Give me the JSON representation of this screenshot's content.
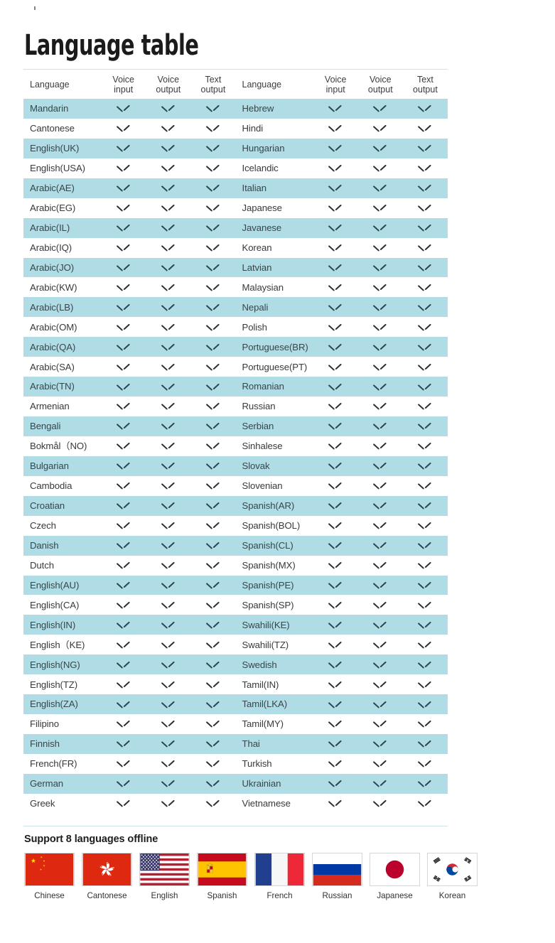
{
  "page_title": "Language table",
  "table": {
    "headers": {
      "language": "Language",
      "voice_input": "Voice\ninput",
      "voice_output": "Voice\noutput",
      "text_output": "Text\noutput",
      "voice_input_l1": "Voice",
      "voice_input_l2": "input",
      "voice_output_l1": "Voice",
      "voice_output_l2": "output",
      "text_output_l1": "Text",
      "text_output_l2": "output"
    },
    "check_glyph": "check-mark",
    "alt_row_color": "#b0dce6",
    "rule_color": "#cfe3ea",
    "left_column": [
      {
        "language": "Mandarin",
        "voice_input": true,
        "voice_output": true,
        "text_output": true
      },
      {
        "language": "Cantonese",
        "voice_input": true,
        "voice_output": true,
        "text_output": true
      },
      {
        "language": "English(UK)",
        "voice_input": true,
        "voice_output": true,
        "text_output": true
      },
      {
        "language": "English(USA)",
        "voice_input": true,
        "voice_output": true,
        "text_output": true
      },
      {
        "language": "Arabic(AE)",
        "voice_input": true,
        "voice_output": true,
        "text_output": true
      },
      {
        "language": "Arabic(EG)",
        "voice_input": true,
        "voice_output": true,
        "text_output": true
      },
      {
        "language": "Arabic(IL)",
        "voice_input": true,
        "voice_output": true,
        "text_output": true
      },
      {
        "language": "Arabic(IQ)",
        "voice_input": true,
        "voice_output": true,
        "text_output": true
      },
      {
        "language": "Arabic(JO)",
        "voice_input": true,
        "voice_output": true,
        "text_output": true
      },
      {
        "language": "Arabic(KW)",
        "voice_input": true,
        "voice_output": true,
        "text_output": true
      },
      {
        "language": "Arabic(LB)",
        "voice_input": true,
        "voice_output": true,
        "text_output": true
      },
      {
        "language": "Arabic(OM)",
        "voice_input": true,
        "voice_output": true,
        "text_output": true
      },
      {
        "language": "Arabic(QA)",
        "voice_input": true,
        "voice_output": true,
        "text_output": true
      },
      {
        "language": "Arabic(SA)",
        "voice_input": true,
        "voice_output": true,
        "text_output": true
      },
      {
        "language": "Arabic(TN)",
        "voice_input": true,
        "voice_output": true,
        "text_output": true
      },
      {
        "language": "Armenian",
        "voice_input": true,
        "voice_output": true,
        "text_output": true
      },
      {
        "language": "Bengali",
        "voice_input": true,
        "voice_output": true,
        "text_output": true
      },
      {
        "language": "Bokmål（NO)",
        "voice_input": true,
        "voice_output": true,
        "text_output": true
      },
      {
        "language": "Bulgarian",
        "voice_input": true,
        "voice_output": true,
        "text_output": true
      },
      {
        "language": "Cambodia",
        "voice_input": true,
        "voice_output": true,
        "text_output": true
      },
      {
        "language": "Croatian",
        "voice_input": true,
        "voice_output": true,
        "text_output": true
      },
      {
        "language": "Czech",
        "voice_input": true,
        "voice_output": true,
        "text_output": true
      },
      {
        "language": "Danish",
        "voice_input": true,
        "voice_output": true,
        "text_output": true
      },
      {
        "language": "Dutch",
        "voice_input": true,
        "voice_output": true,
        "text_output": true
      },
      {
        "language": "English(AU)",
        "voice_input": true,
        "voice_output": true,
        "text_output": true
      },
      {
        "language": "English(CA)",
        "voice_input": true,
        "voice_output": true,
        "text_output": true
      },
      {
        "language": "English(IN)",
        "voice_input": true,
        "voice_output": true,
        "text_output": true
      },
      {
        "language": "English（KE)",
        "voice_input": true,
        "voice_output": true,
        "text_output": true
      },
      {
        "language": "English(NG)",
        "voice_input": true,
        "voice_output": true,
        "text_output": true
      },
      {
        "language": "English(TZ)",
        "voice_input": true,
        "voice_output": true,
        "text_output": true
      },
      {
        "language": "English(ZA)",
        "voice_input": true,
        "voice_output": true,
        "text_output": true
      },
      {
        "language": "Filipino",
        "voice_input": true,
        "voice_output": true,
        "text_output": true
      },
      {
        "language": "Finnish",
        "voice_input": true,
        "voice_output": true,
        "text_output": true
      },
      {
        "language": "French(FR)",
        "voice_input": true,
        "voice_output": true,
        "text_output": true
      },
      {
        "language": "German",
        "voice_input": true,
        "voice_output": true,
        "text_output": true
      },
      {
        "language": "Greek",
        "voice_input": true,
        "voice_output": true,
        "text_output": true
      }
    ],
    "right_column": [
      {
        "language": "Hebrew",
        "voice_input": true,
        "voice_output": true,
        "text_output": true
      },
      {
        "language": "Hindi",
        "voice_input": true,
        "voice_output": true,
        "text_output": true
      },
      {
        "language": "Hungarian",
        "voice_input": true,
        "voice_output": true,
        "text_output": true
      },
      {
        "language": "Icelandic",
        "voice_input": true,
        "voice_output": true,
        "text_output": true
      },
      {
        "language": "Italian",
        "voice_input": true,
        "voice_output": true,
        "text_output": true
      },
      {
        "language": "Japanese",
        "voice_input": true,
        "voice_output": true,
        "text_output": true
      },
      {
        "language": "Javanese",
        "voice_input": true,
        "voice_output": true,
        "text_output": true
      },
      {
        "language": "Korean",
        "voice_input": true,
        "voice_output": true,
        "text_output": true
      },
      {
        "language": "Latvian",
        "voice_input": true,
        "voice_output": true,
        "text_output": true
      },
      {
        "language": "Malaysian",
        "voice_input": true,
        "voice_output": true,
        "text_output": true
      },
      {
        "language": "Nepali",
        "voice_input": true,
        "voice_output": true,
        "text_output": true
      },
      {
        "language": "Polish",
        "voice_input": true,
        "voice_output": true,
        "text_output": true
      },
      {
        "language": "Portuguese(BR)",
        "voice_input": true,
        "voice_output": true,
        "text_output": true
      },
      {
        "language": "Portuguese(PT)",
        "voice_input": true,
        "voice_output": true,
        "text_output": true
      },
      {
        "language": "Romanian",
        "voice_input": true,
        "voice_output": true,
        "text_output": true
      },
      {
        "language": "Russian",
        "voice_input": true,
        "voice_output": true,
        "text_output": true
      },
      {
        "language": "Serbian",
        "voice_input": true,
        "voice_output": true,
        "text_output": true
      },
      {
        "language": "Sinhalese",
        "voice_input": true,
        "voice_output": true,
        "text_output": true
      },
      {
        "language": "Slovak",
        "voice_input": true,
        "voice_output": true,
        "text_output": true
      },
      {
        "language": "Slovenian",
        "voice_input": true,
        "voice_output": true,
        "text_output": true
      },
      {
        "language": "Spanish(AR)",
        "voice_input": true,
        "voice_output": true,
        "text_output": true
      },
      {
        "language": "Spanish(BOL)",
        "voice_input": true,
        "voice_output": true,
        "text_output": true
      },
      {
        "language": "Spanish(CL)",
        "voice_input": true,
        "voice_output": true,
        "text_output": true
      },
      {
        "language": "Spanish(MX)",
        "voice_input": true,
        "voice_output": true,
        "text_output": true
      },
      {
        "language": "Spanish(PE)",
        "voice_input": true,
        "voice_output": true,
        "text_output": true
      },
      {
        "language": "Spanish(SP)",
        "voice_input": true,
        "voice_output": true,
        "text_output": true
      },
      {
        "language": "Swahili(KE)",
        "voice_input": true,
        "voice_output": true,
        "text_output": true
      },
      {
        "language": "Swahili(TZ)",
        "voice_input": true,
        "voice_output": true,
        "text_output": true
      },
      {
        "language": "Swedish",
        "voice_input": true,
        "voice_output": true,
        "text_output": true
      },
      {
        "language": "Tamil(IN)",
        "voice_input": true,
        "voice_output": true,
        "text_output": true
      },
      {
        "language": "Tamil(LKA)",
        "voice_input": true,
        "voice_output": true,
        "text_output": true
      },
      {
        "language": "Tamil(MY)",
        "voice_input": true,
        "voice_output": true,
        "text_output": true
      },
      {
        "language": "Thai",
        "voice_input": true,
        "voice_output": true,
        "text_output": true
      },
      {
        "language": "Turkish",
        "voice_input": true,
        "voice_output": true,
        "text_output": true
      },
      {
        "language": "Ukrainian",
        "voice_input": true,
        "voice_output": true,
        "text_output": true
      },
      {
        "language": "Vietnamese",
        "voice_input": true,
        "voice_output": true,
        "text_output": true
      }
    ]
  },
  "offline": {
    "title": "Support 8 languages offline",
    "flags": [
      {
        "label": "Chinese",
        "icon": "flag-china-icon",
        "code": "cn"
      },
      {
        "label": "Cantonese",
        "icon": "flag-hongkong-icon",
        "code": "hk"
      },
      {
        "label": "English",
        "icon": "flag-usa-icon",
        "code": "us"
      },
      {
        "label": "Spanish",
        "icon": "flag-spain-icon",
        "code": "es"
      },
      {
        "label": "French",
        "icon": "flag-france-icon",
        "code": "fr"
      },
      {
        "label": "Russian",
        "icon": "flag-russia-icon",
        "code": "ru"
      },
      {
        "label": "Japanese",
        "icon": "flag-japan-icon",
        "code": "jp"
      },
      {
        "label": "Korean",
        "icon": "flag-southkorea-icon",
        "code": "kr"
      }
    ]
  }
}
